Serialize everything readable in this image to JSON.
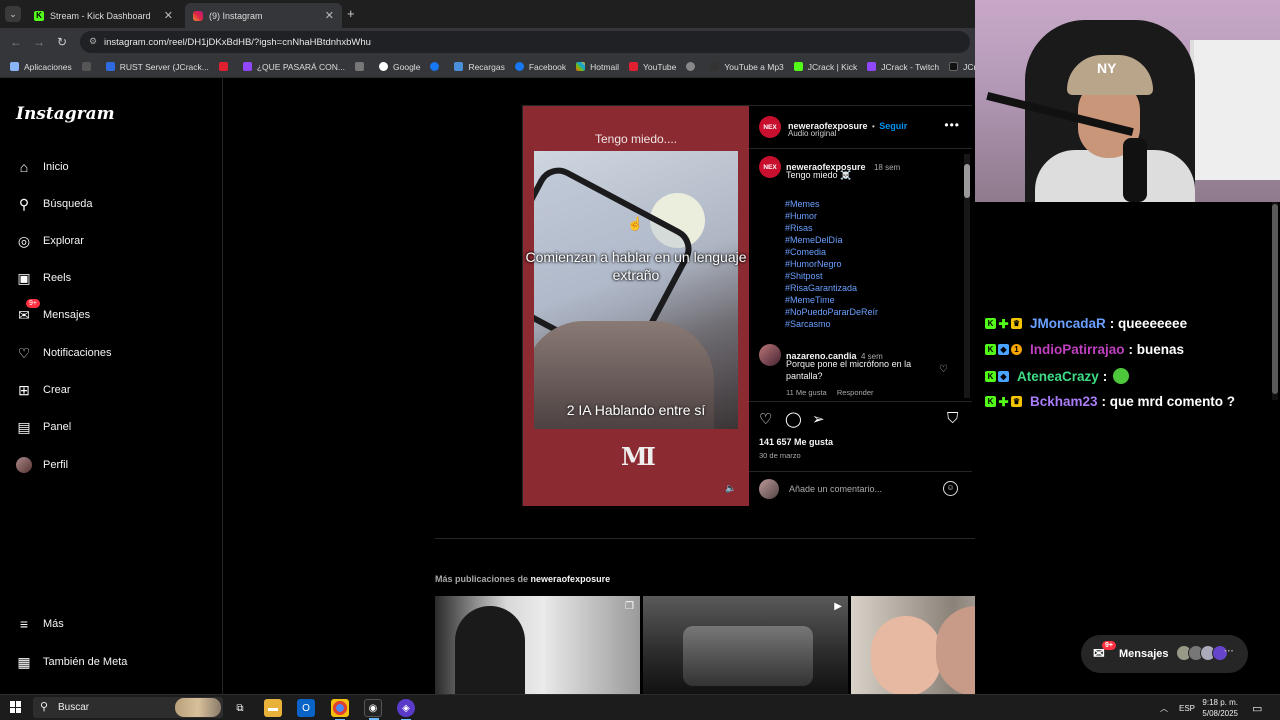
{
  "browser": {
    "tabs": [
      {
        "title": "Stream - Kick Dashboard",
        "active": false
      },
      {
        "title": "(9) Instagram",
        "active": true
      }
    ],
    "url": "instagram.com/reel/DH1jDKxBdHB/?igsh=cnNhaHBtdnhxbWhu",
    "bookmarks": [
      "Aplicaciones",
      "RUST Server (JCrack...",
      "¿QUE PASARÁ CON...",
      "Google",
      "Recargas",
      "Facebook",
      "Hotmail",
      "YouTube",
      "YouTube a Mp3",
      "JCrack | Kick",
      "JCrack - Twitch",
      "JCrack (@JCra"
    ]
  },
  "instagram": {
    "logo": "Instagram",
    "nav": [
      {
        "label": "Inicio",
        "icon": "home-icon"
      },
      {
        "label": "Búsqueda",
        "icon": "search-icon"
      },
      {
        "label": "Explorar",
        "icon": "compass-icon"
      },
      {
        "label": "Reels",
        "icon": "reels-icon"
      },
      {
        "label": "Mensajes",
        "icon": "messenger-icon",
        "badge": "9+"
      },
      {
        "label": "Notificaciones",
        "icon": "heart-icon"
      },
      {
        "label": "Crear",
        "icon": "plus-square-icon"
      },
      {
        "label": "Panel",
        "icon": "chart-icon"
      },
      {
        "label": "Perfil",
        "icon": "avatar"
      }
    ],
    "nav_bottom": [
      {
        "label": "Más",
        "icon": "hamburger-icon"
      },
      {
        "label": "También de Meta",
        "icon": "meta-icon"
      }
    ],
    "post": {
      "author": "neweraofexposure",
      "avatar_text": "NEX",
      "follow": "Seguir",
      "separator": "•",
      "audio": "Audio original",
      "video_text_top": "Tengo miedo....",
      "video_overlay_1": "Comienzan a hablar en un lenguaje extraño",
      "video_overlay_2": "2 IA Hablando entre sí",
      "watermark": "MI",
      "caption": {
        "author": "neweraofexposure",
        "time": "18 sem",
        "text": "Tengo miedo ☠️",
        "hashtags": [
          "#Memes",
          "#Humor",
          "#Risas",
          "#MemeDelDía",
          "#Comedia",
          "#HumorNegro",
          "#Shitpost",
          "#RisaGarantizada",
          "#MemeTime",
          "#NoPuedoPararDeReír",
          "#Sarcasmo"
        ]
      },
      "comment": {
        "author": "nazareno.candia",
        "time": "4 sem",
        "text": "Porque pone el micrófono en la pantalla?",
        "likes": "11 Me gusta",
        "reply": "Responder"
      },
      "likes": "141 657 Me gusta",
      "date": "30 de marzo",
      "add_comment_placeholder": "Añade un comentario..."
    },
    "more_posts": {
      "prefix": "Más publicaciones de",
      "author": "neweraofexposure"
    }
  },
  "chat": [
    {
      "user": "JMoncadaR",
      "color": "#6aa0ff",
      "message": ": queeeeeee",
      "badges": [
        "kick",
        "star",
        "crown"
      ]
    },
    {
      "user": "IndioPatirrajao",
      "color": "#c040c0",
      "message": ": buenas",
      "badges": [
        "kick",
        "gem",
        "one"
      ]
    },
    {
      "user": "AteneaCrazy",
      "color": "#3ddc84",
      "message": ":",
      "badges": [
        "kick",
        "gem"
      ],
      "emote": true
    },
    {
      "user": "Bckham23",
      "color": "#a97cf8",
      "message": ": que mrd comento ?",
      "badges": [
        "kick",
        "star",
        "crown"
      ]
    }
  ],
  "dm_pill": {
    "label": "Mensajes",
    "badge": "9+"
  },
  "webcam": {
    "cap_logo": "NY"
  },
  "taskbar": {
    "search": "Buscar",
    "lang": "ESP",
    "time": "9:18 p. m.",
    "date": "5/08/2025"
  },
  "colors": {
    "accent": "#0095f6",
    "kick_green": "#53fc18",
    "video_bg": "#8b2a30"
  }
}
